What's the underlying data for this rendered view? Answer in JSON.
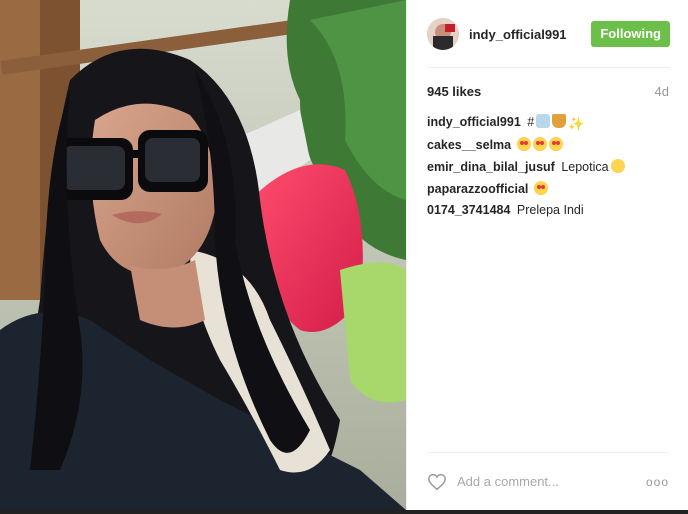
{
  "post": {
    "username": "indy_official991",
    "follow_label": "Following",
    "likes": "945 likes",
    "time": "4d"
  },
  "comments": [
    {
      "user": "indy_official991",
      "text": "#",
      "emoji": [
        "cup",
        "trophy",
        "sparkle"
      ]
    },
    {
      "user": "cakes__selma",
      "text": "",
      "emoji": [
        "heart-eyes",
        "heart-eyes",
        "heart-eyes"
      ]
    },
    {
      "user": "emir_dina_bilal_jusuf",
      "text": "Lepotica",
      "emoji": [
        "smile"
      ]
    },
    {
      "user": "paparazzoofficial",
      "text": "",
      "emoji": [
        "heart-eyes"
      ]
    },
    {
      "user": "0174_3741484",
      "text": "Prelepa Indi",
      "emoji": []
    }
  ],
  "footer": {
    "comment_placeholder": "Add a comment...",
    "more_label": "ooo"
  },
  "colors": {
    "follow_green": "#6cc04a",
    "text_primary": "#262626",
    "text_muted": "#999999"
  }
}
